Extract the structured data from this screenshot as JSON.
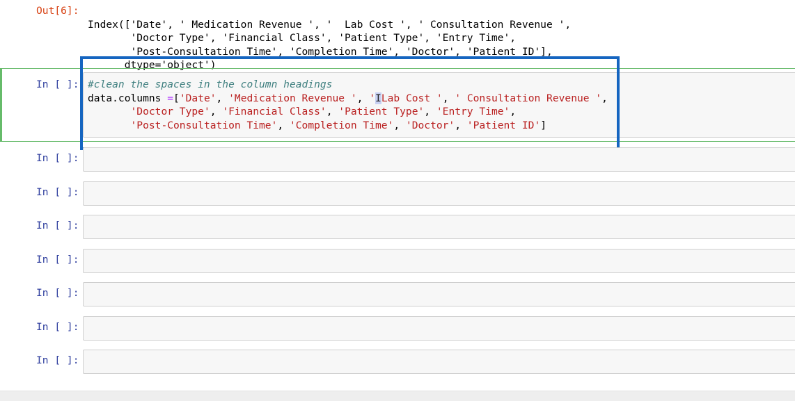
{
  "output_cell": {
    "prompt": "Out[6]:",
    "lines": [
      "Index(['Date', ' Medication Revenue ', '  Lab Cost ', ' Consultation Revenue ',",
      "       'Doctor Type', 'Financial Class', 'Patient Type', 'Entry Time',",
      "       'Post-Consultation Time', 'Completion Time', 'Doctor', 'Patient ID'],",
      "      dtype='object')"
    ]
  },
  "active_cell": {
    "prompt": "In [ ]:",
    "comment": "#clean the spaces in the column headings",
    "line1_var": "data.columns ",
    "line1_op": "=",
    "line1_bracket": "[",
    "line1_str1": "'Date'",
    "line1_sep1": ", ",
    "line1_str2": "'Medication Revenue '",
    "line1_sep2": ", ",
    "line1_str3a": "'",
    "line1_cursor": "I",
    "line1_str3b": "Lab Cost '",
    "line1_sep3": ", ",
    "line1_str4": "' Consultation Revenue '",
    "line1_tail": ",",
    "line2_indent": "       ",
    "line2_str1": "'Doctor Type'",
    "line2_sep1": ", ",
    "line2_str2": "'Financial Class'",
    "line2_sep2": ", ",
    "line2_str3": "'Patient Type'",
    "line2_sep3": ", ",
    "line2_str4": "'Entry Time'",
    "line2_tail": ",",
    "line3_indent": "       ",
    "line3_str1": "'Post-Consultation Time'",
    "line3_sep1": ", ",
    "line3_str2": "'Completion Time'",
    "line3_sep2": ", ",
    "line3_str3": "'Doctor'",
    "line3_sep3": ", ",
    "line3_str4": "'Patient ID'",
    "line3_tail": "]"
  },
  "empty_cells": [
    {
      "prompt": "In [ ]:"
    },
    {
      "prompt": "In [ ]:"
    },
    {
      "prompt": "In [ ]:"
    },
    {
      "prompt": "In [ ]:"
    },
    {
      "prompt": "In [ ]:"
    },
    {
      "prompt": "In [ ]:"
    },
    {
      "prompt": "In [ ]:"
    }
  ],
  "colors": {
    "highlight_box": "#1565c0",
    "active_cell_border": "#66bb6a",
    "out_prompt": "#d84315",
    "in_prompt": "#303f9f",
    "string": "#ba2121",
    "comment": "#408080",
    "operator": "#aa22ff"
  }
}
